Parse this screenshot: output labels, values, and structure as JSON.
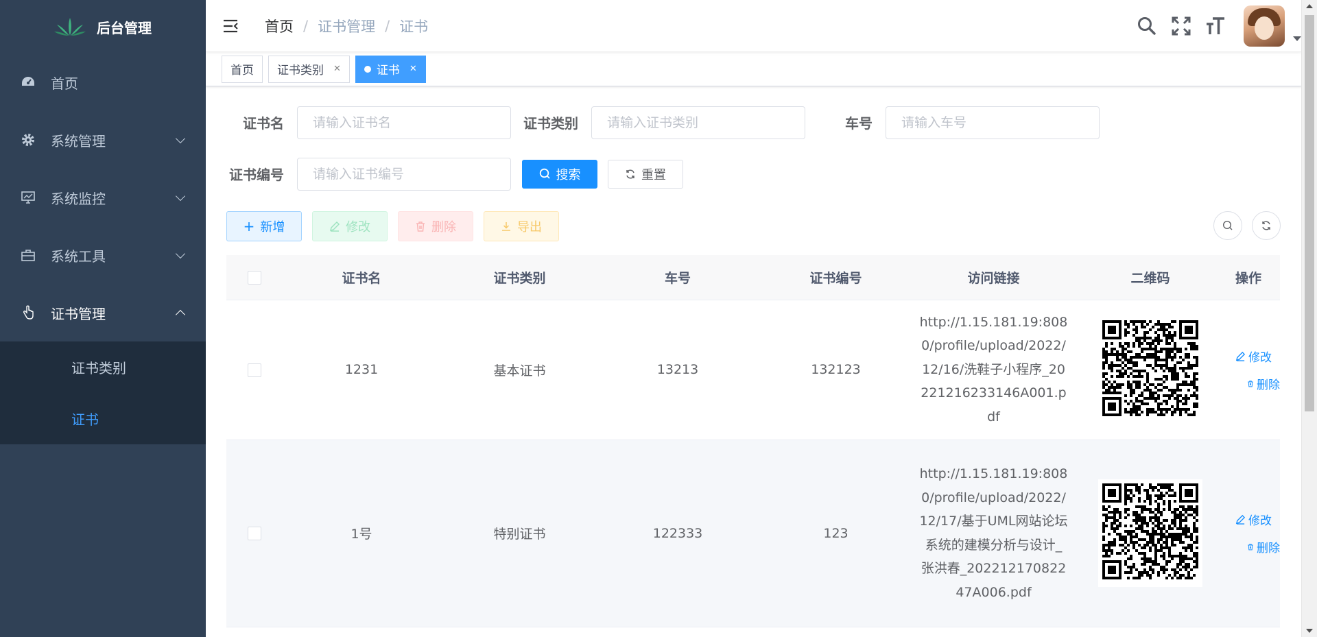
{
  "sidebar": {
    "title": "后台管理",
    "menu": [
      {
        "label": "首页",
        "icon": "dashboard-icon"
      },
      {
        "label": "系统管理",
        "icon": "gear-icon"
      },
      {
        "label": "系统监控",
        "icon": "monitor-icon"
      },
      {
        "label": "系统工具",
        "icon": "toolbox-icon"
      },
      {
        "label": "证书管理",
        "icon": "hand-pointer-icon"
      }
    ],
    "submenu": [
      {
        "label": "证书类别"
      },
      {
        "label": "证书"
      }
    ]
  },
  "navbar": {
    "breadcrumb": [
      "首页",
      "证书管理",
      "证书"
    ],
    "separator": "/"
  },
  "tags": [
    {
      "label": "首页"
    },
    {
      "label": "证书类别"
    },
    {
      "label": "证书"
    }
  ],
  "form": {
    "name_label": "证书名",
    "name_placeholder": "请输入证书名",
    "category_label": "证书类别",
    "category_placeholder": "请输入证书类别",
    "car_label": "车号",
    "car_placeholder": "请输入车号",
    "number_label": "证书编号",
    "number_placeholder": "请输入证书编号",
    "search_button": "搜索",
    "reset_button": "重置"
  },
  "toolbar": {
    "add": "新增",
    "edit": "修改",
    "delete": "删除",
    "export": "导出"
  },
  "table": {
    "columns": [
      "证书名",
      "证书类别",
      "车号",
      "证书编号",
      "访问链接",
      "二维码",
      "操作"
    ],
    "rows": [
      {
        "name": "1231",
        "category": "基本证书",
        "car": "13213",
        "number": "132123",
        "link": "http://1.15.181.19:8080/profile/upload/2022/12/16/洗鞋子小程序_20221216233146A001.pdf"
      },
      {
        "name": "1号",
        "category": "特别证书",
        "car": "122333",
        "number": "123",
        "link": "http://1.15.181.19:8080/profile/upload/2022/12/17/基于UML网站论坛系统的建模分析与设计_张洪春_20221217082247A006.pdf"
      }
    ],
    "op_edit": "修改",
    "op_delete": "删除"
  },
  "colors": {
    "sidebar_bg": "#304156",
    "submenu_bg": "#1f2d3d",
    "primary": "#1890ff",
    "active_tag": "#409eff"
  }
}
